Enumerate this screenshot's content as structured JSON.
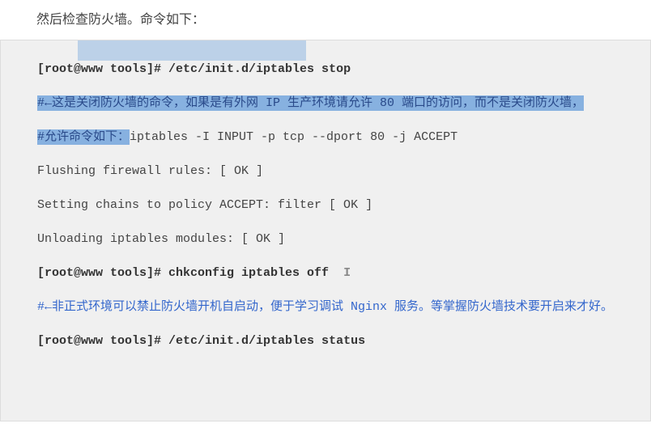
{
  "intro": "然后检查防火墙。命令如下：",
  "lines": {
    "l1_prefix": "[root@www tools]# ",
    "l1_cmd": "/etc/init.d/iptables stop",
    "l2": "#←这是关闭防火墙的命令，如果是有外网 IP 生产环境请允许 80 端口的访问，而不是关闭防火墙，",
    "l3_a": "#允许命令如下：",
    "l3_b": "iptables -I INPUT -p tcp --dport 80 -j ACCEPT",
    "l4": "Flushing firewall rules: [  OK  ]",
    "l5": "Setting chains to policy ACCEPT: filter [  OK  ]",
    "l6": "Unloading iptables modules: [  OK  ]",
    "l7_prefix": "[root@www tools]# ",
    "l7_cmd": "chkconfig iptables off",
    "l8": "#←非正式环境可以禁止防火墙开机自启动，便于学习调试 Nginx 服务。等掌握防火墙技术要开启来才好。",
    "l9_prefix": "[root@www tools]# ",
    "l9_cmd": "/etc/init.d/iptables status"
  },
  "cursor": "I"
}
